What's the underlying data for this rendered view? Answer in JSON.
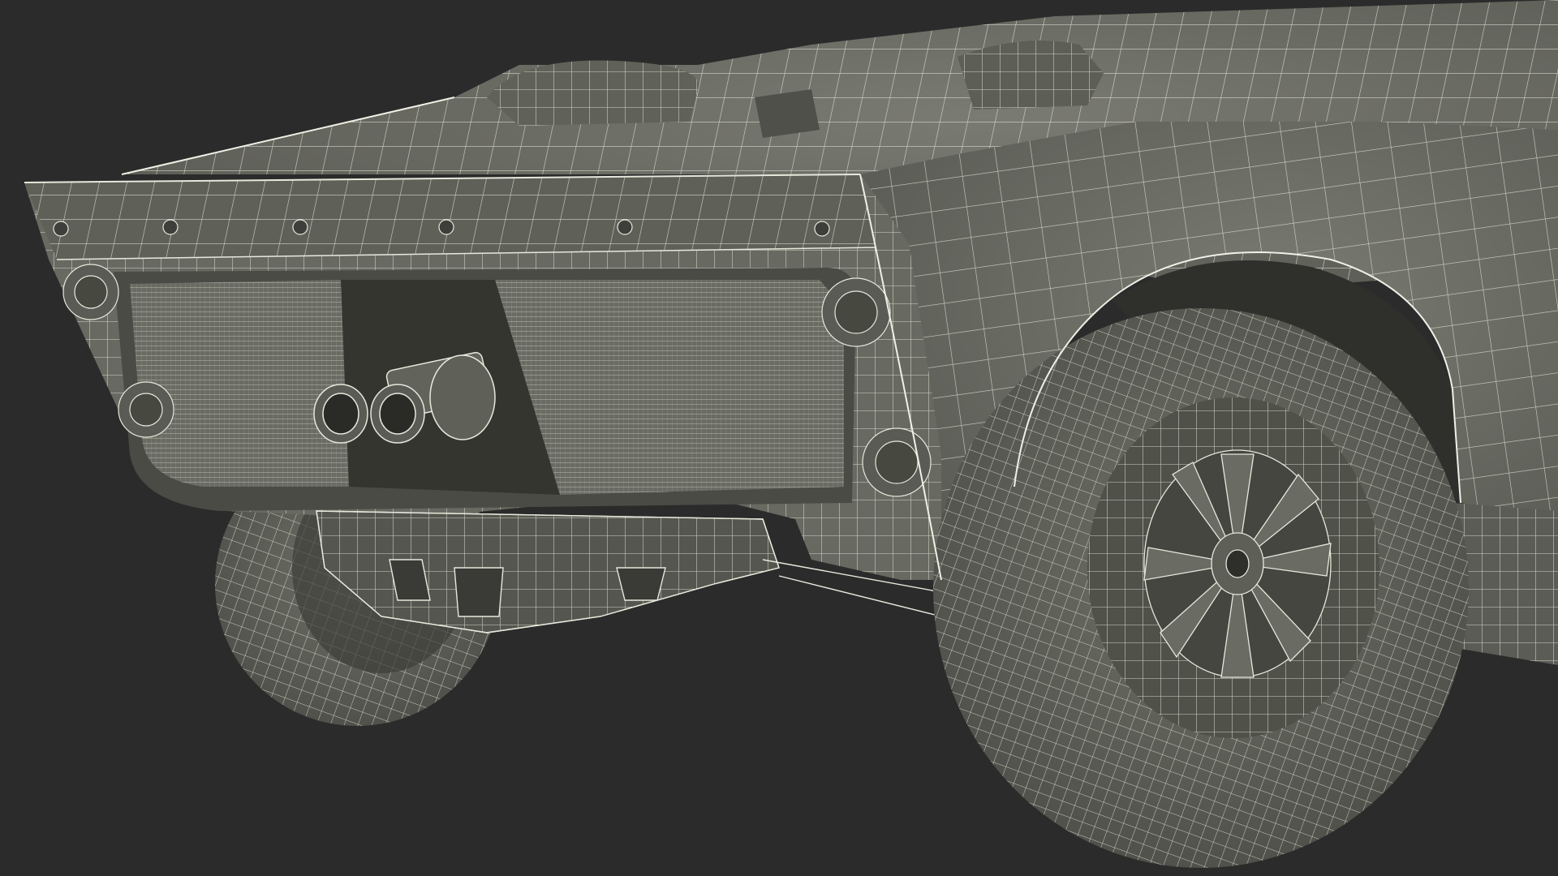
{
  "scene": {
    "background_color": "#2b2b2b",
    "model_fill_color": "#6e6f66",
    "model_shadow_color": "#4a4b45",
    "model_dark_color": "#363733",
    "wireframe_color": "#e8e8dc",
    "subject": "car-rear-wireframe-model"
  }
}
